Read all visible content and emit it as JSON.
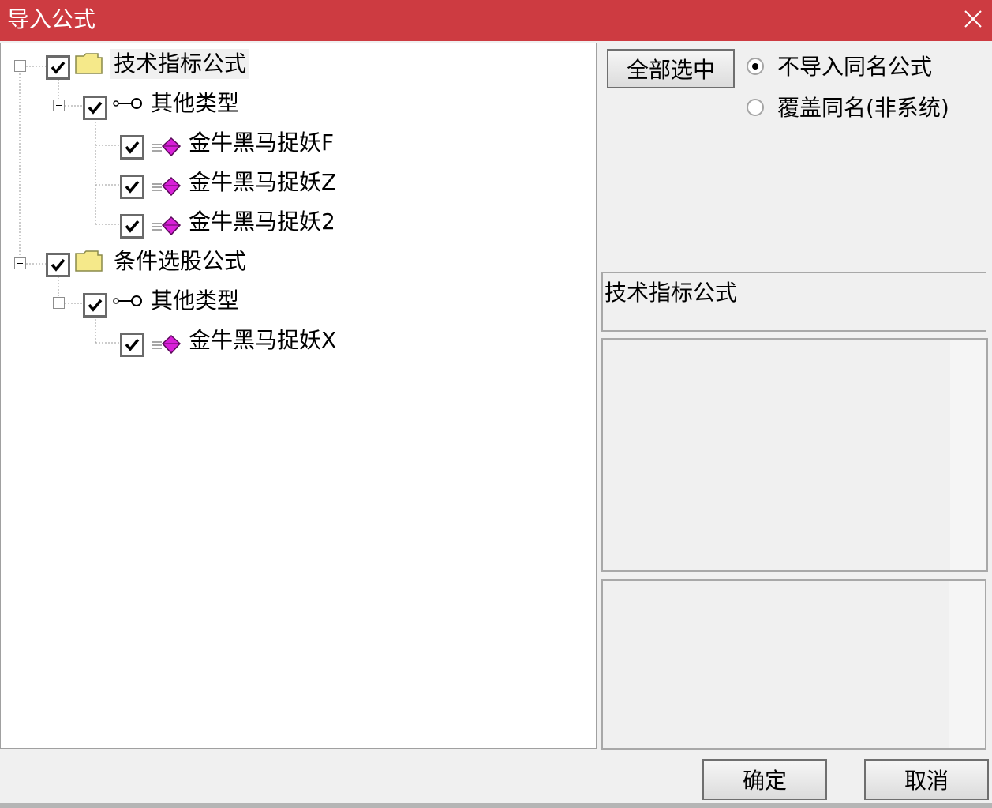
{
  "window": {
    "title": "导入公式",
    "close_icon": "close-icon"
  },
  "tree": {
    "nodes": [
      {
        "label": "技术指标公式",
        "icon": "folder-icon",
        "checked": true,
        "expanded": true
      },
      {
        "label": "其他类型",
        "icon": "key-icon",
        "checked": true,
        "expanded": true
      },
      {
        "label": "金牛黑马捉妖F",
        "icon": "formula-icon",
        "checked": true
      },
      {
        "label": "金牛黑马捉妖Z",
        "icon": "formula-icon",
        "checked": true
      },
      {
        "label": "金牛黑马捉妖2",
        "icon": "formula-icon",
        "checked": true
      },
      {
        "label": "条件选股公式",
        "icon": "folder-icon",
        "checked": true,
        "expanded": true
      },
      {
        "label": "其他类型",
        "icon": "key-icon",
        "checked": true,
        "expanded": true
      },
      {
        "label": "金牛黑马捉妖X",
        "icon": "formula-icon",
        "checked": true
      }
    ]
  },
  "options": {
    "select_all_label": "全部选中",
    "radio_skip_label": "不导入同名公式",
    "radio_overwrite_label": "覆盖同名(非系统)",
    "selected_radio": "skip"
  },
  "info": {
    "type_text": "技术指标公式"
  },
  "footer": {
    "ok_label": "确定",
    "cancel_label": "取消"
  },
  "colors": {
    "titlebar": "#cd3b41",
    "folder": "#f5e98a",
    "formula": "#d81fd8"
  }
}
